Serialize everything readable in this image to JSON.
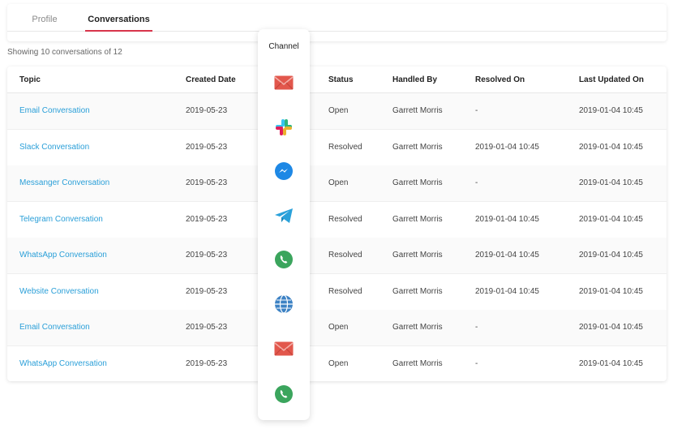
{
  "tabs": [
    {
      "label": "Profile",
      "active": false
    },
    {
      "label": "Conversations",
      "active": true
    }
  ],
  "showing_text": "Showing 10 conversations of 12",
  "table": {
    "headers": {
      "topic": "Topic",
      "created": "Created Date",
      "status": "Status",
      "handled": "Handled By",
      "resolved": "Resolved On",
      "updated": "Last Updated On"
    },
    "rows": [
      {
        "topic": "Email Conversation",
        "created": "2019-05-23",
        "status": "Open",
        "handled": "Garrett Morris",
        "resolved": "-",
        "updated": "2019-01-04  10:45"
      },
      {
        "topic": "Slack Conversation",
        "created": "2019-05-23",
        "status": "Resolved",
        "handled": "Garrett Morris",
        "resolved": "2019-01-04  10:45",
        "updated": "2019-01-04  10:45"
      },
      {
        "topic": "Messanger Conversation",
        "created": "2019-05-23",
        "status": "Open",
        "handled": "Garrett Morris",
        "resolved": "-",
        "updated": "2019-01-04  10:45"
      },
      {
        "topic": "Telegram Conversation",
        "created": "2019-05-23",
        "status": "Resolved",
        "handled": "Garrett Morris",
        "resolved": "2019-01-04  10:45",
        "updated": "2019-01-04  10:45"
      },
      {
        "topic": "WhatsApp Conversation",
        "created": "2019-05-23",
        "status": "Resolved",
        "handled": "Garrett Morris",
        "resolved": "2019-01-04  10:45",
        "updated": "2019-01-04  10:45"
      },
      {
        "topic": "Website Conversation",
        "created": "2019-05-23",
        "status": "Resolved",
        "handled": "Garrett Morris",
        "resolved": "2019-01-04  10:45",
        "updated": "2019-01-04  10:45"
      },
      {
        "topic": "Email Conversation",
        "created": "2019-05-23",
        "status": "Open",
        "handled": "Garrett Morris",
        "resolved": "-",
        "updated": "2019-01-04  10:45"
      },
      {
        "topic": "WhatsApp Conversation",
        "created": "2019-05-23",
        "status": "Open",
        "handled": "Garrett Morris",
        "resolved": "-",
        "updated": "2019-01-04  10:45"
      }
    ]
  },
  "channel": {
    "title": "Channel",
    "icons": [
      "email-icon",
      "slack-icon",
      "messenger-icon",
      "telegram-icon",
      "whatsapp-icon",
      "website-globe-icon",
      "email-icon",
      "whatsapp-icon"
    ]
  },
  "colors": {
    "accent": "#d8344b",
    "link": "#2a9fd8",
    "email": "#e2574c",
    "messenger": "#1e88e5",
    "telegram": "#2aa1da",
    "whatsapp": "#3ba55d",
    "globe": "#3d82c4"
  }
}
